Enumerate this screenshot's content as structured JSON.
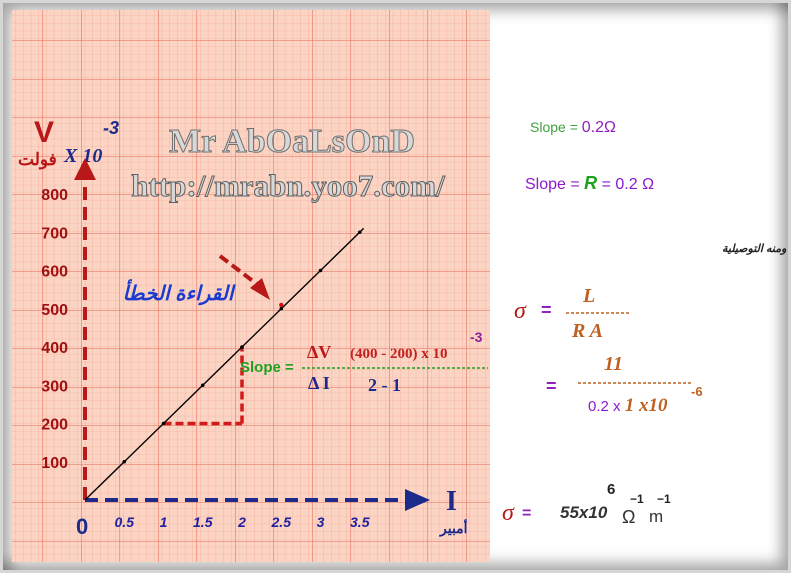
{
  "watermark": {
    "name": "Mr AbOaLsOnD",
    "url": "http://mrabn.yoo7.com/"
  },
  "graph": {
    "y_axis_symbol": "V",
    "y_axis_unit": "فولت",
    "y_axis_multiplier": "X 10",
    "y_axis_exponent": "-3",
    "x_axis_symbol": "I",
    "x_axis_unit": "أمبير",
    "origin": "0",
    "y_ticks": [
      "100",
      "200",
      "300",
      "400",
      "500",
      "600",
      "700",
      "800"
    ],
    "x_ticks": [
      "0.5",
      "1",
      "1.5",
      "2",
      "2.5",
      "3",
      "3.5"
    ],
    "wrong_reading_label": "القراءة الخطأ",
    "colors": {
      "paper": "#fbd4c4",
      "grid_minor": "#f3a28e",
      "grid_major": "#e46a5a",
      "axis_y": "#b81818",
      "axis_x": "#1c2a8c",
      "tick_labels": "#a01010",
      "x_tick_labels": "#2020a0",
      "triangle": "#d21a1a",
      "line": "#000000"
    }
  },
  "slope_calc": {
    "label": "Slope =",
    "numerator": "ΔV",
    "denominator": "Δ I",
    "values_numerator": "(400 - 200) x 10",
    "values_exponent": "-3",
    "values_denominator": "2  -  1"
  },
  "results": {
    "slope_value_line": {
      "prefix": "Slope = ",
      "value": "0.2",
      "unit": "Ω"
    },
    "slope_r_line": {
      "prefix": "Slope = ",
      "r": "R",
      "eq": " = 0.2  Ω"
    },
    "and_from_conductivity": "ومنه التوصيلية",
    "sigma": "σ",
    "eq": "=",
    "frac1_num": "L",
    "frac1_den": "R  A",
    "frac2_num": "11",
    "frac2_den_a": "0.2 x ",
    "frac2_den_b": "1 x10",
    "frac2_den_exp": "-6",
    "final_value": "55x10",
    "final_exp": "6",
    "final_unit": "Ω",
    "final_unit_exp": "−1",
    "final_unit2": "m",
    "final_unit2_exp": "−1"
  },
  "chart_data": {
    "type": "line",
    "x": [
      0,
      0.5,
      1,
      1.5,
      2,
      2.5,
      3,
      3.5
    ],
    "y": [
      0,
      100,
      200,
      300,
      400,
      500,
      600,
      700
    ],
    "wrong_point": {
      "x": 2.5,
      "y": 510
    },
    "slope_triangle": {
      "x1": 1,
      "x2": 2,
      "y1": 200,
      "y2": 400
    },
    "xlabel": "I أمبير",
    "ylabel": "V فولت X 10 -3",
    "xlim": [
      0,
      4.25
    ],
    "ylim": [
      0,
      950
    ],
    "grid": true
  }
}
